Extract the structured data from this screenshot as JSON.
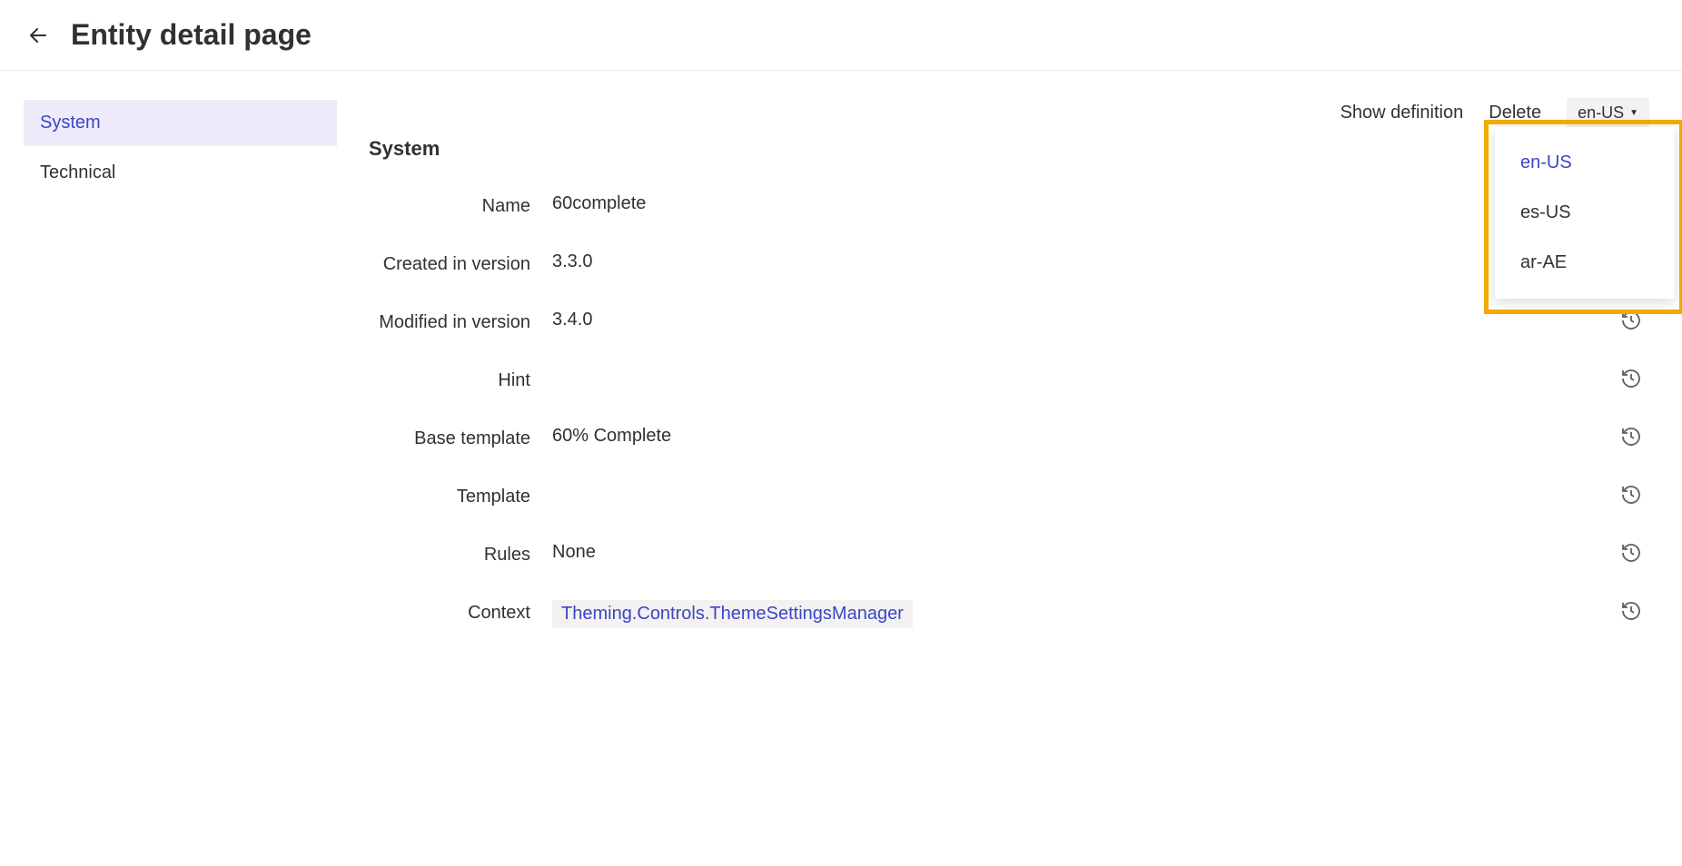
{
  "header": {
    "title": "Entity detail page"
  },
  "sidebar": {
    "items": [
      {
        "label": "System",
        "active": true
      },
      {
        "label": "Technical",
        "active": false
      }
    ]
  },
  "toolbar": {
    "show_definition": "Show definition",
    "delete": "Delete",
    "locale_selected": "en-US",
    "locale_options": [
      "en-US",
      "es-US",
      "ar-AE"
    ]
  },
  "section": {
    "heading": "System",
    "fields": [
      {
        "label": "Name",
        "value": "60complete",
        "history": false,
        "link": false
      },
      {
        "label": "Created in version",
        "value": "3.3.0",
        "history": false,
        "link": false
      },
      {
        "label": "Modified in version",
        "value": "3.4.0",
        "history": true,
        "link": false
      },
      {
        "label": "Hint",
        "value": "",
        "history": true,
        "link": false
      },
      {
        "label": "Base template",
        "value": "60% Complete",
        "history": true,
        "link": false
      },
      {
        "label": "Template",
        "value": "",
        "history": true,
        "link": false
      },
      {
        "label": "Rules",
        "value": "None",
        "history": true,
        "link": false
      },
      {
        "label": "Context",
        "value": "Theming.Controls.ThemeSettingsManager",
        "history": true,
        "link": true
      }
    ]
  }
}
